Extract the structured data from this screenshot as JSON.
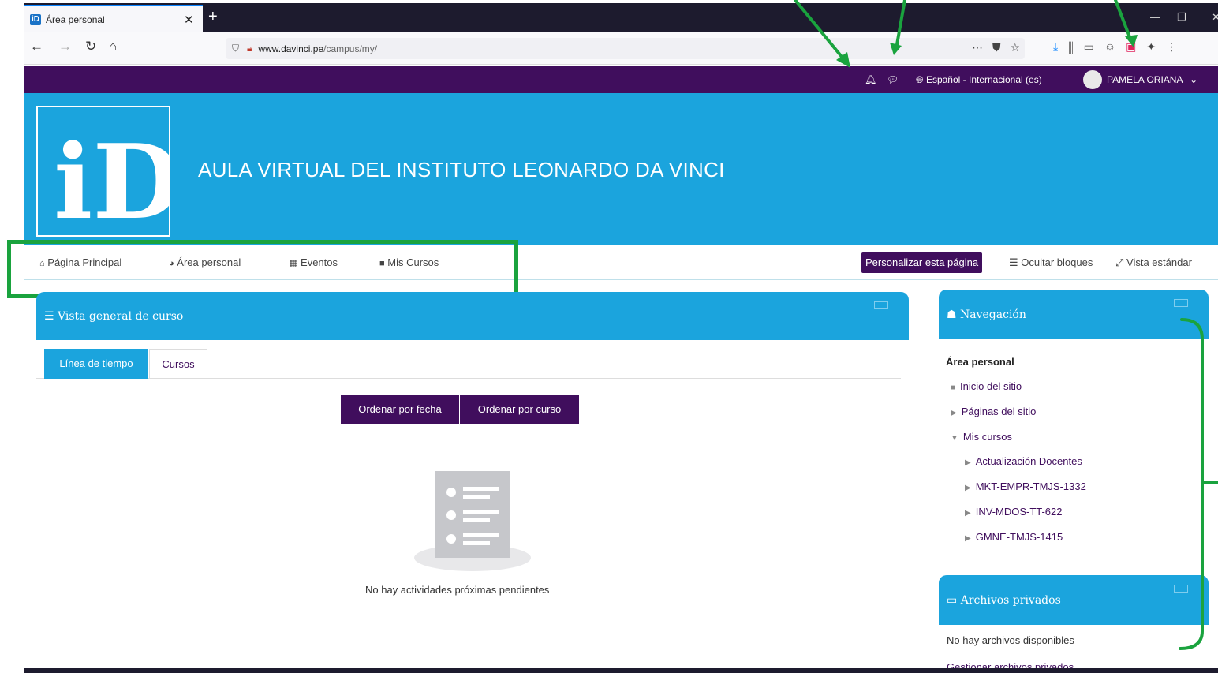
{
  "browser": {
    "tab_title": "Área personal",
    "tab_favicon": "iD",
    "url_host": "www.davinci.pe",
    "url_path": "/campus/my/"
  },
  "topbar": {
    "language": "Español - Internacional (es)",
    "user_name": "PAMELA ORIANA"
  },
  "header": {
    "site_title": "AULA VIRTUAL DEL INSTITUTO LEONARDO DA VINCI",
    "logo_text": "iD"
  },
  "nav": {
    "items": [
      "Página Principal",
      "Área personal",
      "Eventos",
      "Mis Cursos"
    ],
    "customize_button": "Personalizar esta página",
    "hide_blocks": "Ocultar bloques",
    "standard_view": "Vista estándar"
  },
  "course_overview": {
    "title": "Vista general de curso",
    "tab_timeline": "Línea de tiempo",
    "tab_courses": "Cursos",
    "sort_by_date": "Ordenar por fecha",
    "sort_by_course": "Ordenar por curso",
    "empty_message": "No hay actividades próximas pendientes"
  },
  "navigation_block": {
    "title": "Navegación",
    "root": "Área personal",
    "items": [
      "Inicio del sitio",
      "Páginas del sitio",
      "Mis cursos"
    ],
    "courses": [
      "Actualización Docentes",
      "MKT-EMPR-TMJS-1332",
      "INV-MDOS-TT-622",
      "GMNE-TMJS-1415"
    ]
  },
  "files_block": {
    "title": "Archivos privados",
    "empty_text": "No hay archivos disponibles",
    "manage_link": "Gestionar archivos privados..."
  },
  "colors": {
    "purple": "#400e5d",
    "blue": "#1ba4dd",
    "annotation_green": "#1aa33e"
  }
}
